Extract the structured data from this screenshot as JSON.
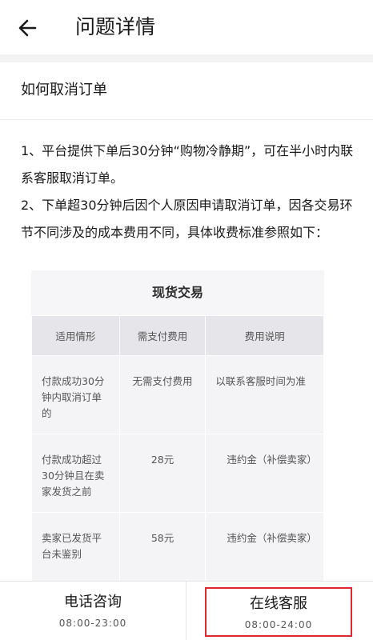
{
  "header": {
    "back_icon": "arrow-left-icon",
    "title": "问题详情"
  },
  "question": {
    "title": "如何取消订单"
  },
  "answer": {
    "paragraph1": "1、平台提供下单后30分钟“购物冷静期”，可在半小时内联系客服取消订单。",
    "paragraph2": "2、下单超30分钟后因个人原因申请取消订单，因各交易环节不同涉及的成本费用不同，具体收费标准参照如下："
  },
  "fee_table": {
    "title": "现货交易",
    "headers": [
      "适用情形",
      "需支付费用",
      "费用说明"
    ],
    "rows": [
      {
        "scenario": "付款成功30分钟内取消订单的",
        "fee": "无需支付费用",
        "note": "以联系客服时间为准"
      },
      {
        "scenario": "付款成功超过30分钟且在卖家发货之前",
        "fee": "28元",
        "note": "违约金（补偿卖家）"
      },
      {
        "scenario": "卖家已发货平台未鉴别",
        "fee": "58元",
        "note": "违约金（补偿卖家）"
      }
    ]
  },
  "bottom": {
    "phone": {
      "label": "电话咨询",
      "hours": "08:00-23:00"
    },
    "online": {
      "label": "在线客服",
      "hours": "08:00-24:00"
    },
    "highlight_color": "#e0282e"
  }
}
